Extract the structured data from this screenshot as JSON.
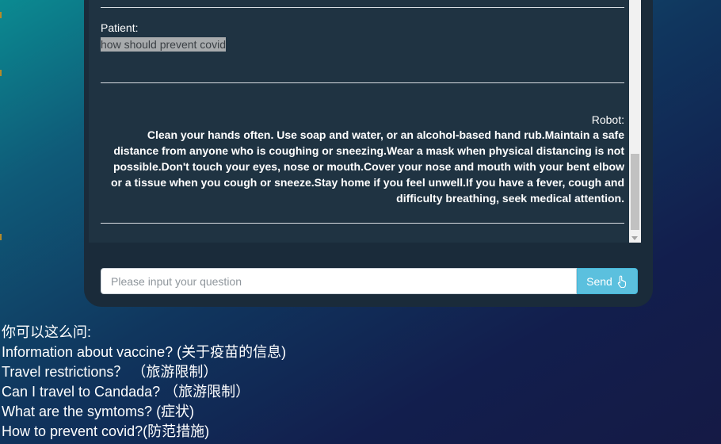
{
  "conversation": {
    "patient_label": "Patient:",
    "patient_message": "how should prevent covid",
    "robot_label": "Robot:",
    "robot_message": "Clean your hands often. Use soap and water, or an alcohol-based hand rub.Maintain a safe distance from anyone who is coughing or sneezing.Wear a mask when physical distancing is not possible.Don't touch your eyes, nose or mouth.Cover your nose and mouth with your bent elbow or a tissue when you cough or sneeze.Stay home if you feel unwell.If you have a fever, cough and difficulty breathing, seek medical attention."
  },
  "input": {
    "placeholder": "Please input your question",
    "value": "",
    "send_label": "Send",
    "send_icon": "hand-pointer-icon"
  },
  "suggestions": {
    "heading": "你可以这么问:",
    "items": [
      "Information about vaccine? (关于疫苗的信息)",
      "Travel restrictions？ （旅游限制）",
      "Can I travel to Candada? （旅游限制）",
      "What are the symtoms? (症状)",
      "How to prevent covid?(防范措施)"
    ]
  },
  "colors": {
    "panel_background": "#1f3342",
    "send_button": "#5bc0de",
    "text": "#ffffff"
  }
}
